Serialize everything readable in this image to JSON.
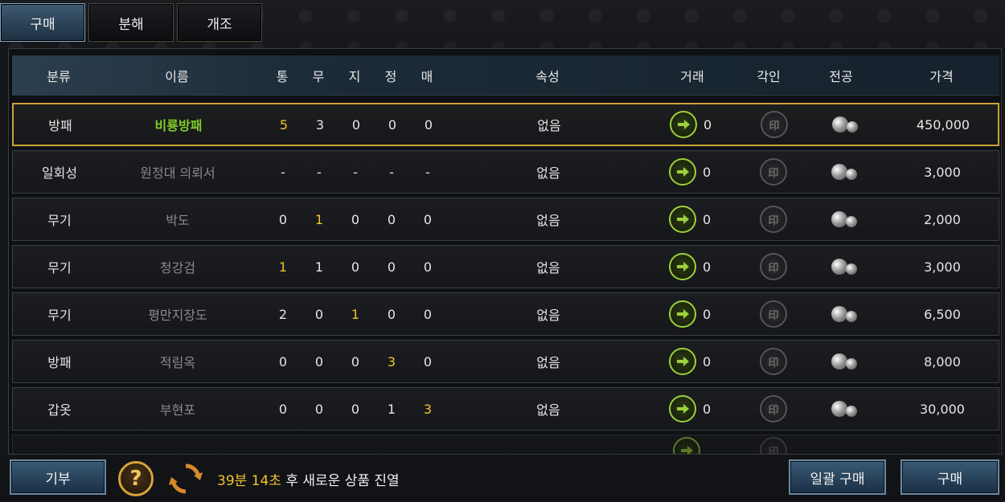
{
  "tabs": [
    {
      "label": "구매",
      "active": true
    },
    {
      "label": "분해",
      "active": false
    },
    {
      "label": "개조",
      "active": false
    }
  ],
  "columns": {
    "category": "분류",
    "name": "이름",
    "s1": "통",
    "s2": "무",
    "s3": "지",
    "s4": "정",
    "s5": "매",
    "attribute": "속성",
    "trade": "거래",
    "engrave": "각인",
    "special": "전공",
    "price": "가격"
  },
  "rows": [
    {
      "category": "방패",
      "name": "비룡방패",
      "stats": [
        "5",
        "3",
        "0",
        "0",
        "0"
      ],
      "highlight": [
        0
      ],
      "attribute": "없음",
      "trade": "0",
      "price": "450,000",
      "selected": true
    },
    {
      "category": "일회성",
      "name": "원정대 의뢰서",
      "stats": [
        "-",
        "-",
        "-",
        "-",
        "-"
      ],
      "highlight": [],
      "attribute": "없음",
      "trade": "0",
      "price": "3,000",
      "selected": false
    },
    {
      "category": "무기",
      "name": "박도",
      "stats": [
        "0",
        "1",
        "0",
        "0",
        "0"
      ],
      "highlight": [
        1
      ],
      "attribute": "없음",
      "trade": "0",
      "price": "2,000",
      "selected": false
    },
    {
      "category": "무기",
      "name": "청강검",
      "stats": [
        "1",
        "1",
        "0",
        "0",
        "0"
      ],
      "highlight": [
        0
      ],
      "attribute": "없음",
      "trade": "0",
      "price": "3,000",
      "selected": false
    },
    {
      "category": "무기",
      "name": "평만지장도",
      "stats": [
        "2",
        "0",
        "1",
        "0",
        "0"
      ],
      "highlight": [
        2
      ],
      "attribute": "없음",
      "trade": "0",
      "price": "6,500",
      "selected": false
    },
    {
      "category": "방패",
      "name": "적림옥",
      "stats": [
        "0",
        "0",
        "0",
        "3",
        "0"
      ],
      "highlight": [
        3
      ],
      "attribute": "없음",
      "trade": "0",
      "price": "8,000",
      "selected": false
    },
    {
      "category": "갑옷",
      "name": "부현포",
      "stats": [
        "0",
        "0",
        "0",
        "1",
        "3"
      ],
      "highlight": [
        4
      ],
      "attribute": "없음",
      "trade": "0",
      "price": "30,000",
      "selected": false
    }
  ],
  "icons": {
    "trade": "arrow-right-icon",
    "engrave": "seal-icon",
    "special": "bead-icon"
  },
  "bottom": {
    "donate_label": "기부",
    "timer_time": "39분 14초",
    "timer_suffix": " 후 새로운 상품 진열",
    "bulk_buy_label": "일괄 구매",
    "buy_label": "구매"
  },
  "colors": {
    "accent_gold": "#c9a33a",
    "highlight_yellow": "#f2c42c",
    "name_green": "#7fca2a",
    "trade_green": "#9bd13a"
  }
}
